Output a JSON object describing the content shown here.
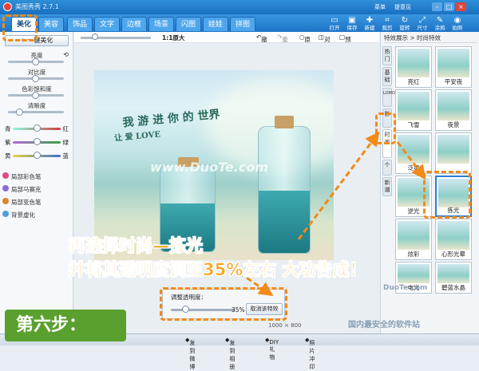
{
  "window": {
    "title": "美图秀秀 2.7.1",
    "links": [
      "菜单",
      "提意见"
    ]
  },
  "tabs": [
    "美化",
    "美容",
    "饰品",
    "文字",
    "边框",
    "场景",
    "闪图",
    "娃娃",
    "拼图"
  ],
  "tools": [
    {
      "icon": "folder-icon",
      "label": "打开"
    },
    {
      "icon": "save-icon",
      "label": "保存"
    },
    {
      "icon": "new-icon",
      "label": "新建"
    },
    {
      "icon": "crop-icon",
      "label": "裁剪"
    },
    {
      "icon": "rotate-icon",
      "label": "旋转"
    },
    {
      "icon": "resize-icon",
      "label": "尺寸"
    },
    {
      "icon": "eyedropper-icon",
      "label": "涂鸦"
    },
    {
      "icon": "camera-icon",
      "label": "拍照"
    }
  ],
  "left": {
    "onekey": "一键美化",
    "sliders": [
      {
        "label": "亮度",
        "pos": 0.45
      },
      {
        "label": "对比度",
        "pos": 0.45
      },
      {
        "label": "色彩饱和度",
        "pos": 0.45
      },
      {
        "label": "清晰度",
        "pos": 0.18
      }
    ],
    "color_sliders": [
      {
        "left": "青",
        "right": "红",
        "color": "#d23c3c"
      },
      {
        "left": "紫",
        "right": "绿",
        "color": "#3aa043"
      },
      {
        "left": "黄",
        "right": "蓝",
        "color": "#3a6fd0"
      }
    ],
    "tools": [
      {
        "label": "局部彩色笔",
        "color": "#e04a8a"
      },
      {
        "label": "局部马赛克",
        "color": "#8a6ad8"
      },
      {
        "label": "局部变色笔",
        "color": "#d8862a"
      },
      {
        "label": "背景虚化",
        "color": "#4aa0d8"
      }
    ]
  },
  "centertop": {
    "undo": "撤销",
    "redo": "重做",
    "original": "原图",
    "compare": "对比",
    "preview": "预览",
    "zoom": "1:1原大"
  },
  "opacity": {
    "label": "调整透明度：",
    "value": "35%",
    "cancel": "取消该特效",
    "pos": 0.35
  },
  "image_size": "1000 × 800",
  "right": {
    "header": "特效展示 > 时尚特效",
    "vtabs": [
      "热门",
      "基础",
      "LOMO",
      "影",
      "时尚",
      "个",
      "新潮"
    ],
    "thumbs": [
      {
        "name": "亮红"
      },
      {
        "name": "平安夜"
      },
      {
        "name": "飞雪"
      },
      {
        "name": "夜景"
      },
      {
        "name": "泛黄"
      },
      {
        "name": ""
      },
      {
        "name": "逆光"
      },
      {
        "name": "拣光"
      },
      {
        "name": "炫彩"
      },
      {
        "name": "心形光晕"
      },
      {
        "name": "电光"
      },
      {
        "name": "碧蓝水晶"
      }
    ]
  },
  "statusbar": {
    "items": [
      "发到微博",
      "发到相册",
      "DIY礼物",
      "照片冲印"
    ]
  },
  "annotation": {
    "line1": "再选择时尚—拣光",
    "line2": "并将其透明度调至35%左右 大功告成！",
    "step": "第六步："
  },
  "photo": {
    "caption": "我 游 进 你 的 世界",
    "caption2": "让 爱 LOVE",
    "watermark": "www.DuoTe.com"
  },
  "watermark": {
    "site": "DuoTe.com",
    "slogan": "国内最安全的软件站"
  }
}
